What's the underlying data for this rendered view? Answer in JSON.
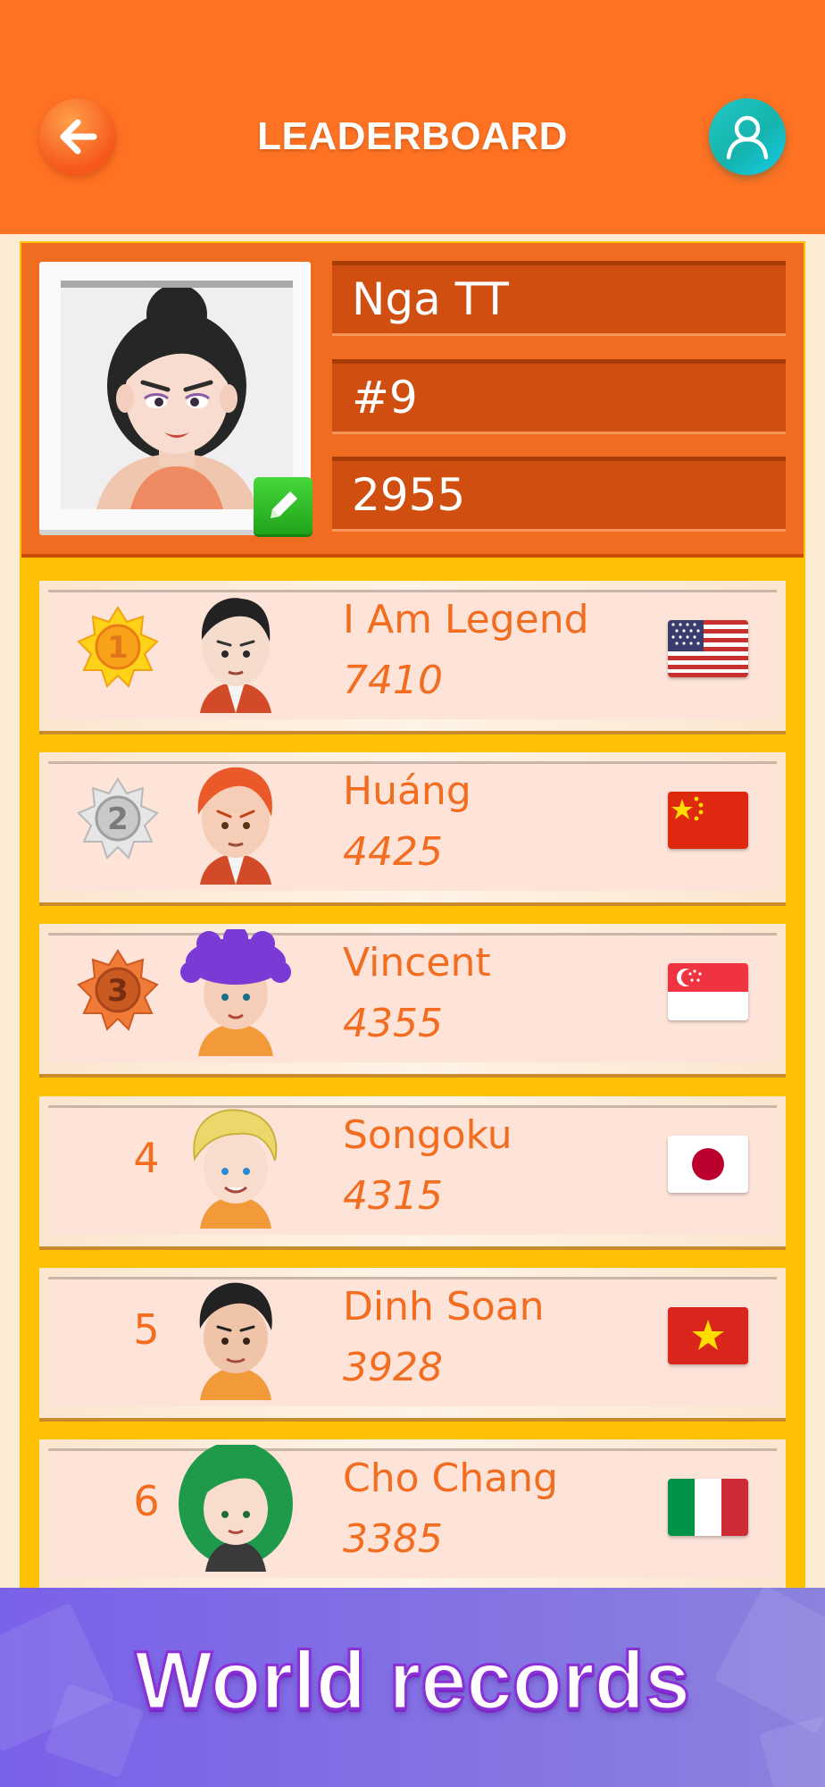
{
  "header": {
    "title": "LEADERBOARD",
    "back_icon": "arrow-left-icon",
    "profile_icon": "user-icon",
    "colors": {
      "header_bg": "#fe7223",
      "profile_btn": "#1fc1c0"
    }
  },
  "me": {
    "name": "Nga TT",
    "rank": "#9",
    "score": "2955",
    "edit_icon": "pencil-icon"
  },
  "players": [
    {
      "rank": "1",
      "name": "I Am Legend",
      "score": "7410",
      "flag": "us-flag",
      "medal": "gold"
    },
    {
      "rank": "2",
      "name": "Huáng",
      "score": "4425",
      "flag": "china-flag",
      "medal": "silver"
    },
    {
      "rank": "3",
      "name": "Vincent",
      "score": "4355",
      "flag": "singapore-flag",
      "medal": "bronze"
    },
    {
      "rank": "4",
      "name": "Songoku",
      "score": "4315",
      "flag": "japan-flag"
    },
    {
      "rank": "5",
      "name": "Dinh Soan",
      "score": "3928",
      "flag": "vietnam-flag"
    },
    {
      "rank": "6",
      "name": "Cho Chang",
      "score": "3385",
      "flag": "italy-flag"
    }
  ],
  "banner": {
    "text": "World records"
  }
}
